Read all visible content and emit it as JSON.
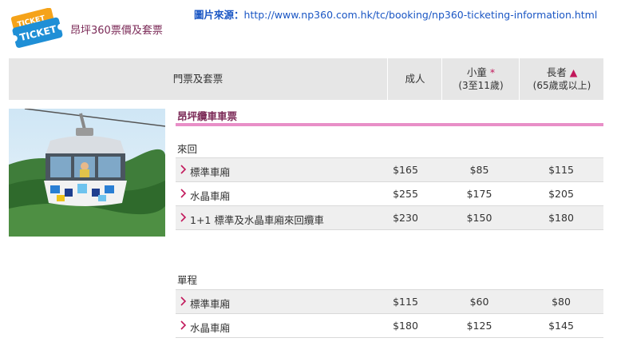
{
  "header": {
    "logo_text_top": "TICKET",
    "logo_text_main": "TICKET",
    "title": "昂坪360票價及套票",
    "source_label": "圖片來源：",
    "source_url": "http://www.np360.com.hk/tc/booking/np360-ticketing-information.html"
  },
  "table": {
    "columns": {
      "name": "門票及套票",
      "adult": "成人",
      "child": "小童",
      "child_mark": "*",
      "child_sub": "(3至11歲)",
      "senior": "長者",
      "senior_mark": "▲",
      "senior_sub": "(65歲或以上)"
    },
    "section_title": "昂坪纜車車票",
    "groups": [
      {
        "label": "來回",
        "rows": [
          {
            "name": "標準車廂",
            "adult": "$165",
            "child": "$85",
            "senior": "$115"
          },
          {
            "name": "水晶車廂",
            "adult": "$255",
            "child": "$175",
            "senior": "$205"
          },
          {
            "name": "1+1 標準及水晶車廂來回纜車",
            "adult": "$230",
            "child": "$150",
            "senior": "$180"
          }
        ]
      },
      {
        "label": "單程",
        "rows": [
          {
            "name": "標準車廂",
            "adult": "$115",
            "child": "$60",
            "senior": "$80"
          },
          {
            "name": "水晶車廂",
            "adult": "$180",
            "child": "$125",
            "senior": "$145"
          }
        ]
      }
    ]
  },
  "colors": {
    "accent_pink": "#e88fc7",
    "title_purple": "#7b2a57",
    "link_blue": "#1a56c4",
    "logo_blue": "#1f8fd6",
    "logo_orange": "#f5a31a"
  },
  "icons": {
    "row_marker": "chevron-right-icon",
    "logo": "ticket-icon"
  }
}
